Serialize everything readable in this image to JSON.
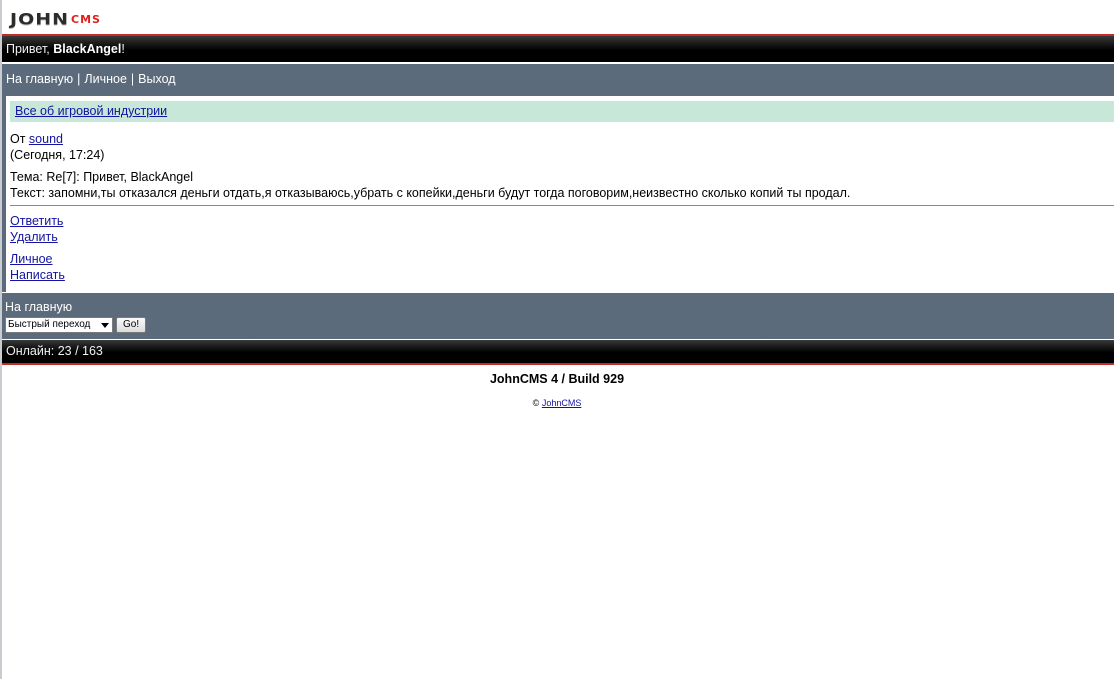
{
  "logo": {
    "part1": "JOHN",
    "part2": "CMS"
  },
  "header": {
    "greeting": "Привет, ",
    "username": "BlackAngel",
    "suffix": "!"
  },
  "nav": {
    "home": "На главную",
    "sep1": "|",
    "personal": "Личное",
    "sep2": "|",
    "logout": "Выход"
  },
  "message": {
    "topic_link": "Все об игровой индустрии",
    "from_label": "От ",
    "from_user": "sound",
    "time": "(Сегодня, 17:24)",
    "subject": "Тема: Re[7]: Привет, BlackAngel",
    "text": "Текст: запомни,ты отказался деньги отдать,я отказываюсь,убрать с копейки,деньги будут тогда поговорим,неизвестно сколько копий ты продал."
  },
  "actions": {
    "reply": "Ответить",
    "delete": "Удалить",
    "personal": "Личное",
    "write": "Написать"
  },
  "bottom_nav": {
    "home": "На главную",
    "quick_select": "Быстрый переход",
    "go": "Go!"
  },
  "footer": {
    "online": "Онлайн: 23 / 163"
  },
  "build": "JohnCMS 4 / Build 929",
  "copyright": {
    "symbol": "©",
    "link": "JohnCMS"
  },
  "colors": {
    "header_bg": "#000000",
    "accent_red": "#c32a2a",
    "nav_bg": "#5b6b7c",
    "topic_bg": "#c7e8d8",
    "link": "#1414a0"
  }
}
